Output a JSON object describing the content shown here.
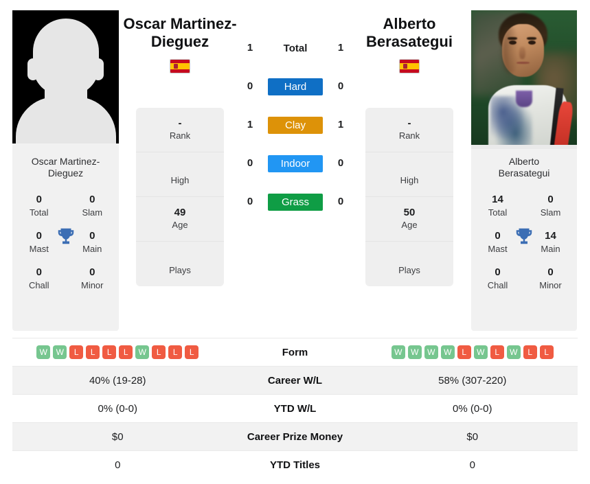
{
  "colors": {
    "hard": "#0f6fc5",
    "clay": "#dd9208",
    "indoor": "#2196f3",
    "grass": "#0f9d45",
    "win": "#76c68f",
    "loss": "#f05b42",
    "trophy": "#3c6eb4"
  },
  "players": {
    "left": {
      "name": "Oscar Martinez-Dieguez",
      "name_line1": "Oscar Martinez-",
      "name_line2": "Dieguez",
      "flag": "spain-flag",
      "caption_line1": "Oscar Martinez-",
      "caption_line2": "Dieguez",
      "rank": "-",
      "rank_label": "Rank",
      "high": "",
      "high_label": "High",
      "age": "49",
      "age_label": "Age",
      "plays": "",
      "plays_label": "Plays",
      "titles": {
        "total": "0",
        "total_label": "Total",
        "slam": "0",
        "slam_label": "Slam",
        "mast": "0",
        "mast_label": "Mast",
        "main": "0",
        "main_label": "Main",
        "chall": "0",
        "chall_label": "Chall",
        "minor": "0",
        "minor_label": "Minor"
      },
      "form": [
        "W",
        "W",
        "L",
        "L",
        "L",
        "L",
        "W",
        "L",
        "L",
        "L"
      ],
      "career_wl": "40% (19-28)",
      "ytd_wl": "0% (0-0)",
      "prize_money": "$0",
      "ytd_titles": "0"
    },
    "right": {
      "name": "Alberto Berasategui",
      "name_line1": "Alberto",
      "name_line2": "Berasategui",
      "flag": "spain-flag",
      "caption_line1": "Alberto",
      "caption_line2": "Berasategui",
      "rank": "-",
      "rank_label": "Rank",
      "high": "",
      "high_label": "High",
      "age": "50",
      "age_label": "Age",
      "plays": "",
      "plays_label": "Plays",
      "titles": {
        "total": "14",
        "total_label": "Total",
        "slam": "0",
        "slam_label": "Slam",
        "mast": "0",
        "mast_label": "Mast",
        "main": "14",
        "main_label": "Main",
        "chall": "0",
        "chall_label": "Chall",
        "minor": "0",
        "minor_label": "Minor"
      },
      "form": [
        "W",
        "W",
        "W",
        "W",
        "L",
        "W",
        "L",
        "W",
        "L",
        "L"
      ],
      "career_wl": "58% (307-220)",
      "ytd_wl": "0% (0-0)",
      "prize_money": "$0",
      "ytd_titles": "0"
    }
  },
  "head_to_head": {
    "rows": [
      {
        "label": "Total",
        "left": "1",
        "right": "1",
        "chip": false,
        "key": "total"
      },
      {
        "label": "Hard",
        "left": "0",
        "right": "0",
        "chip": true,
        "key": "hard"
      },
      {
        "label": "Clay",
        "left": "1",
        "right": "1",
        "chip": true,
        "key": "clay"
      },
      {
        "label": "Indoor",
        "left": "0",
        "right": "0",
        "chip": true,
        "key": "indoor"
      },
      {
        "label": "Grass",
        "left": "0",
        "right": "0",
        "chip": true,
        "key": "grass"
      }
    ]
  },
  "stats_table": {
    "rows": [
      {
        "label": "Form",
        "type": "form"
      },
      {
        "label": "Career W/L",
        "type": "text",
        "left": "40% (19-28)",
        "right": "58% (307-220)"
      },
      {
        "label": "YTD W/L",
        "type": "text",
        "left": "0% (0-0)",
        "right": "0% (0-0)"
      },
      {
        "label": "Career Prize Money",
        "type": "text",
        "left": "$0",
        "right": "$0"
      },
      {
        "label": "YTD Titles",
        "type": "text",
        "left": "0",
        "right": "0"
      }
    ]
  }
}
